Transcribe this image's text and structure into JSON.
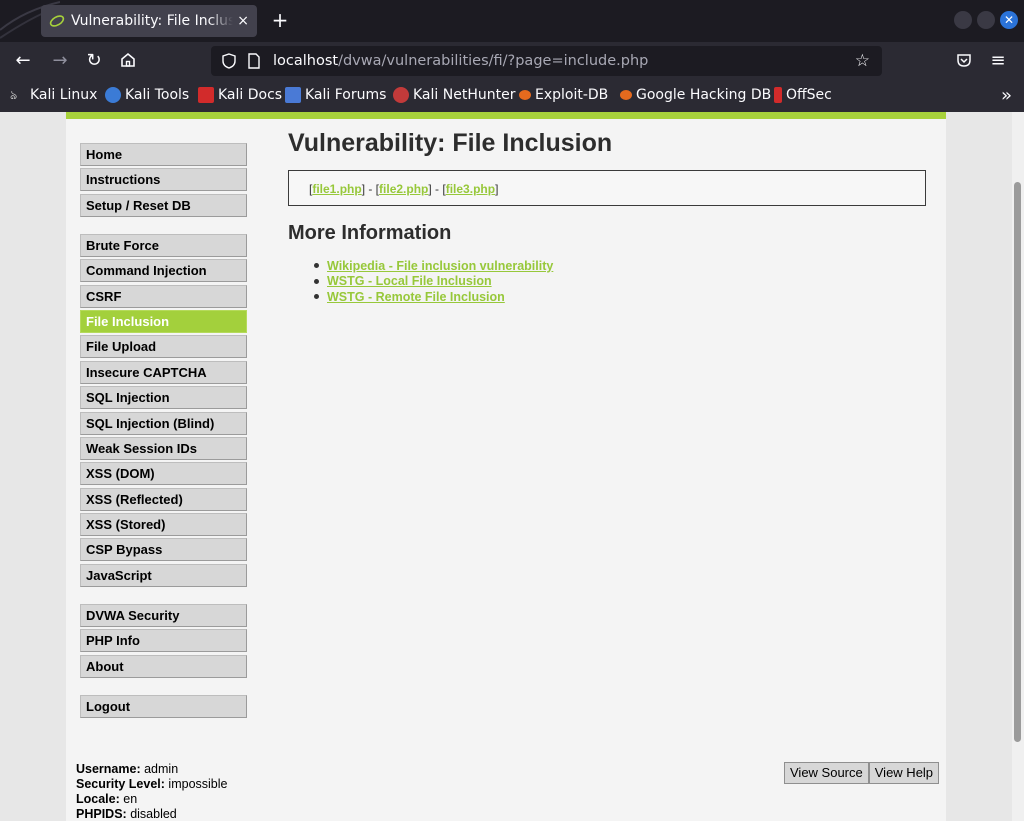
{
  "browser": {
    "tab_title": "Vulnerability: File Inclusion",
    "tab_close": "×",
    "new_tab": "+",
    "url_host": "localhost",
    "url_path": "/dvwa/vulnerabilities/fi/?page=include.php",
    "bookmarks": [
      {
        "label": "Kali Linux",
        "icon": "kali-dragon-icon"
      },
      {
        "label": "Kali Tools",
        "icon": "kali-tools-icon"
      },
      {
        "label": "Kali Docs",
        "icon": "kali-docs-icon"
      },
      {
        "label": "Kali Forums",
        "icon": "kali-forums-icon"
      },
      {
        "label": "Kali NetHunter",
        "icon": "nethunter-icon"
      },
      {
        "label": "Exploit-DB",
        "icon": "exploit-db-icon"
      },
      {
        "label": "Google Hacking DB",
        "icon": "ghdb-icon"
      },
      {
        "label": "OffSec",
        "icon": "offsec-icon"
      }
    ]
  },
  "menu": {
    "group1": [
      "Home",
      "Instructions",
      "Setup / Reset DB"
    ],
    "group2": [
      "Brute Force",
      "Command Injection",
      "CSRF",
      "File Inclusion",
      "File Upload",
      "Insecure CAPTCHA",
      "SQL Injection",
      "SQL Injection (Blind)",
      "Weak Session IDs",
      "XSS (DOM)",
      "XSS (Reflected)",
      "XSS (Stored)",
      "CSP Bypass",
      "JavaScript"
    ],
    "group3": [
      "DVWA Security",
      "PHP Info",
      "About"
    ],
    "group4": [
      "Logout"
    ],
    "active": "File Inclusion"
  },
  "main": {
    "title": "Vulnerability: File Inclusion",
    "files": [
      "file1.php",
      "file2.php",
      "file3.php"
    ],
    "more_title": "More Information",
    "links": [
      "Wikipedia - File inclusion vulnerability",
      "WSTG - Local File Inclusion",
      "WSTG - Remote File Inclusion"
    ]
  },
  "info": {
    "username_label": "Username:",
    "username": "admin",
    "security_label": "Security Level:",
    "security": "impossible",
    "locale_label": "Locale:",
    "locale": "en",
    "phpids_label": "PHPIDS:",
    "phpids": "disabled"
  },
  "buttons": {
    "view_source": "View Source",
    "view_help": "View Help"
  },
  "colors": {
    "accent_green": "#a7d13b",
    "link_green": "#97c83a"
  }
}
